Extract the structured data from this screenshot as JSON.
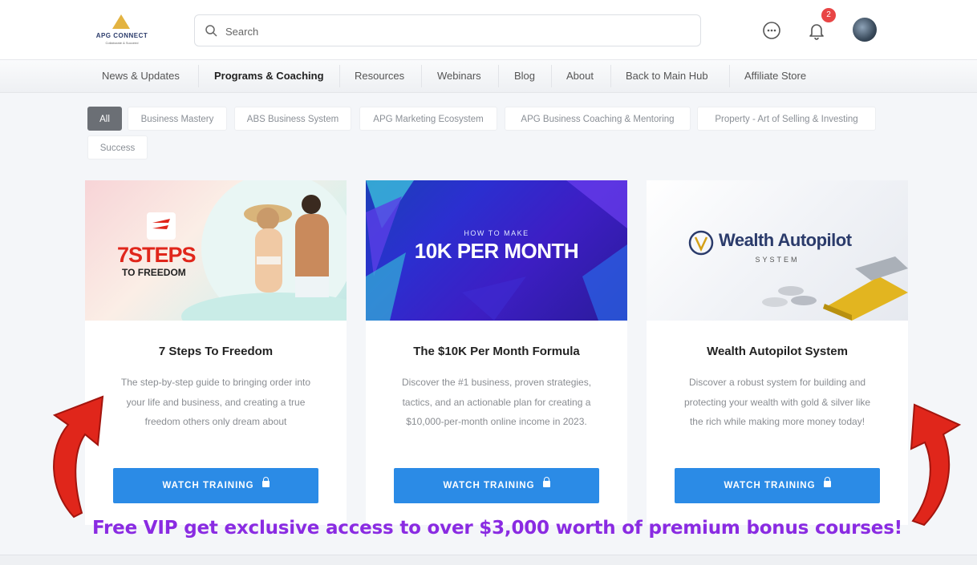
{
  "brand": {
    "name": "APG CONNECT",
    "tagline": "Collaborate & Succeed"
  },
  "search": {
    "placeholder": "Search"
  },
  "notifications": {
    "count": "2"
  },
  "icons": {
    "search": "search-icon",
    "chat": "chat-bubble-icon",
    "bell": "bell-icon",
    "lock": "lock-icon",
    "arrow": "red-curved-arrow-icon"
  },
  "nav": {
    "items": [
      "News & Updates",
      "Programs & Coaching",
      "Resources",
      "Webinars",
      "Blog",
      "About",
      "Back to Main Hub",
      "Affiliate Store"
    ],
    "active": "Programs & Coaching"
  },
  "filters": {
    "items": [
      "All",
      "Business Mastery",
      "ABS Business System",
      "APG Marketing Ecosystem",
      "APG Business Coaching & Mentoring",
      "Property - Art of Selling & Investing",
      "Success"
    ],
    "active": "All"
  },
  "cards": [
    {
      "image_text_1": "7STEPS",
      "image_text_2": "TO FREEDOM",
      "title": "7 Steps To Freedom",
      "desc_1": "The step-by-step guide to bringing order into",
      "desc_2": "your life and business, and creating a true",
      "desc_3": "freedom others only dream about",
      "button": "WATCH TRAINING"
    },
    {
      "image_text_1": "HOW TO MAKE",
      "image_text_2": "10K PER MONTH",
      "title": "The $10K Per Month Formula",
      "desc_1": "Discover the #1 business, proven strategies,",
      "desc_2": "tactics, and an actionable plan for creating a",
      "desc_3": "$10,000-per-month online income in 2023.",
      "button": "WATCH TRAINING"
    },
    {
      "image_text_1": "Wealth Autopilot",
      "image_text_2": "SYSTEM",
      "title": "Wealth Autopilot System",
      "desc_1": "Discover a robust system for building and",
      "desc_2": "protecting your wealth with gold & silver like",
      "desc_3": "the rich while making more money today!",
      "button": "WATCH TRAINING"
    }
  ],
  "promo": "Free VIP get exclusive access to over $3,000 worth of premium bonus courses!",
  "colors": {
    "accent": "#2b8be6",
    "promo": "#8a2be2",
    "badge": "#e84545",
    "arrow": "#e0261b"
  }
}
